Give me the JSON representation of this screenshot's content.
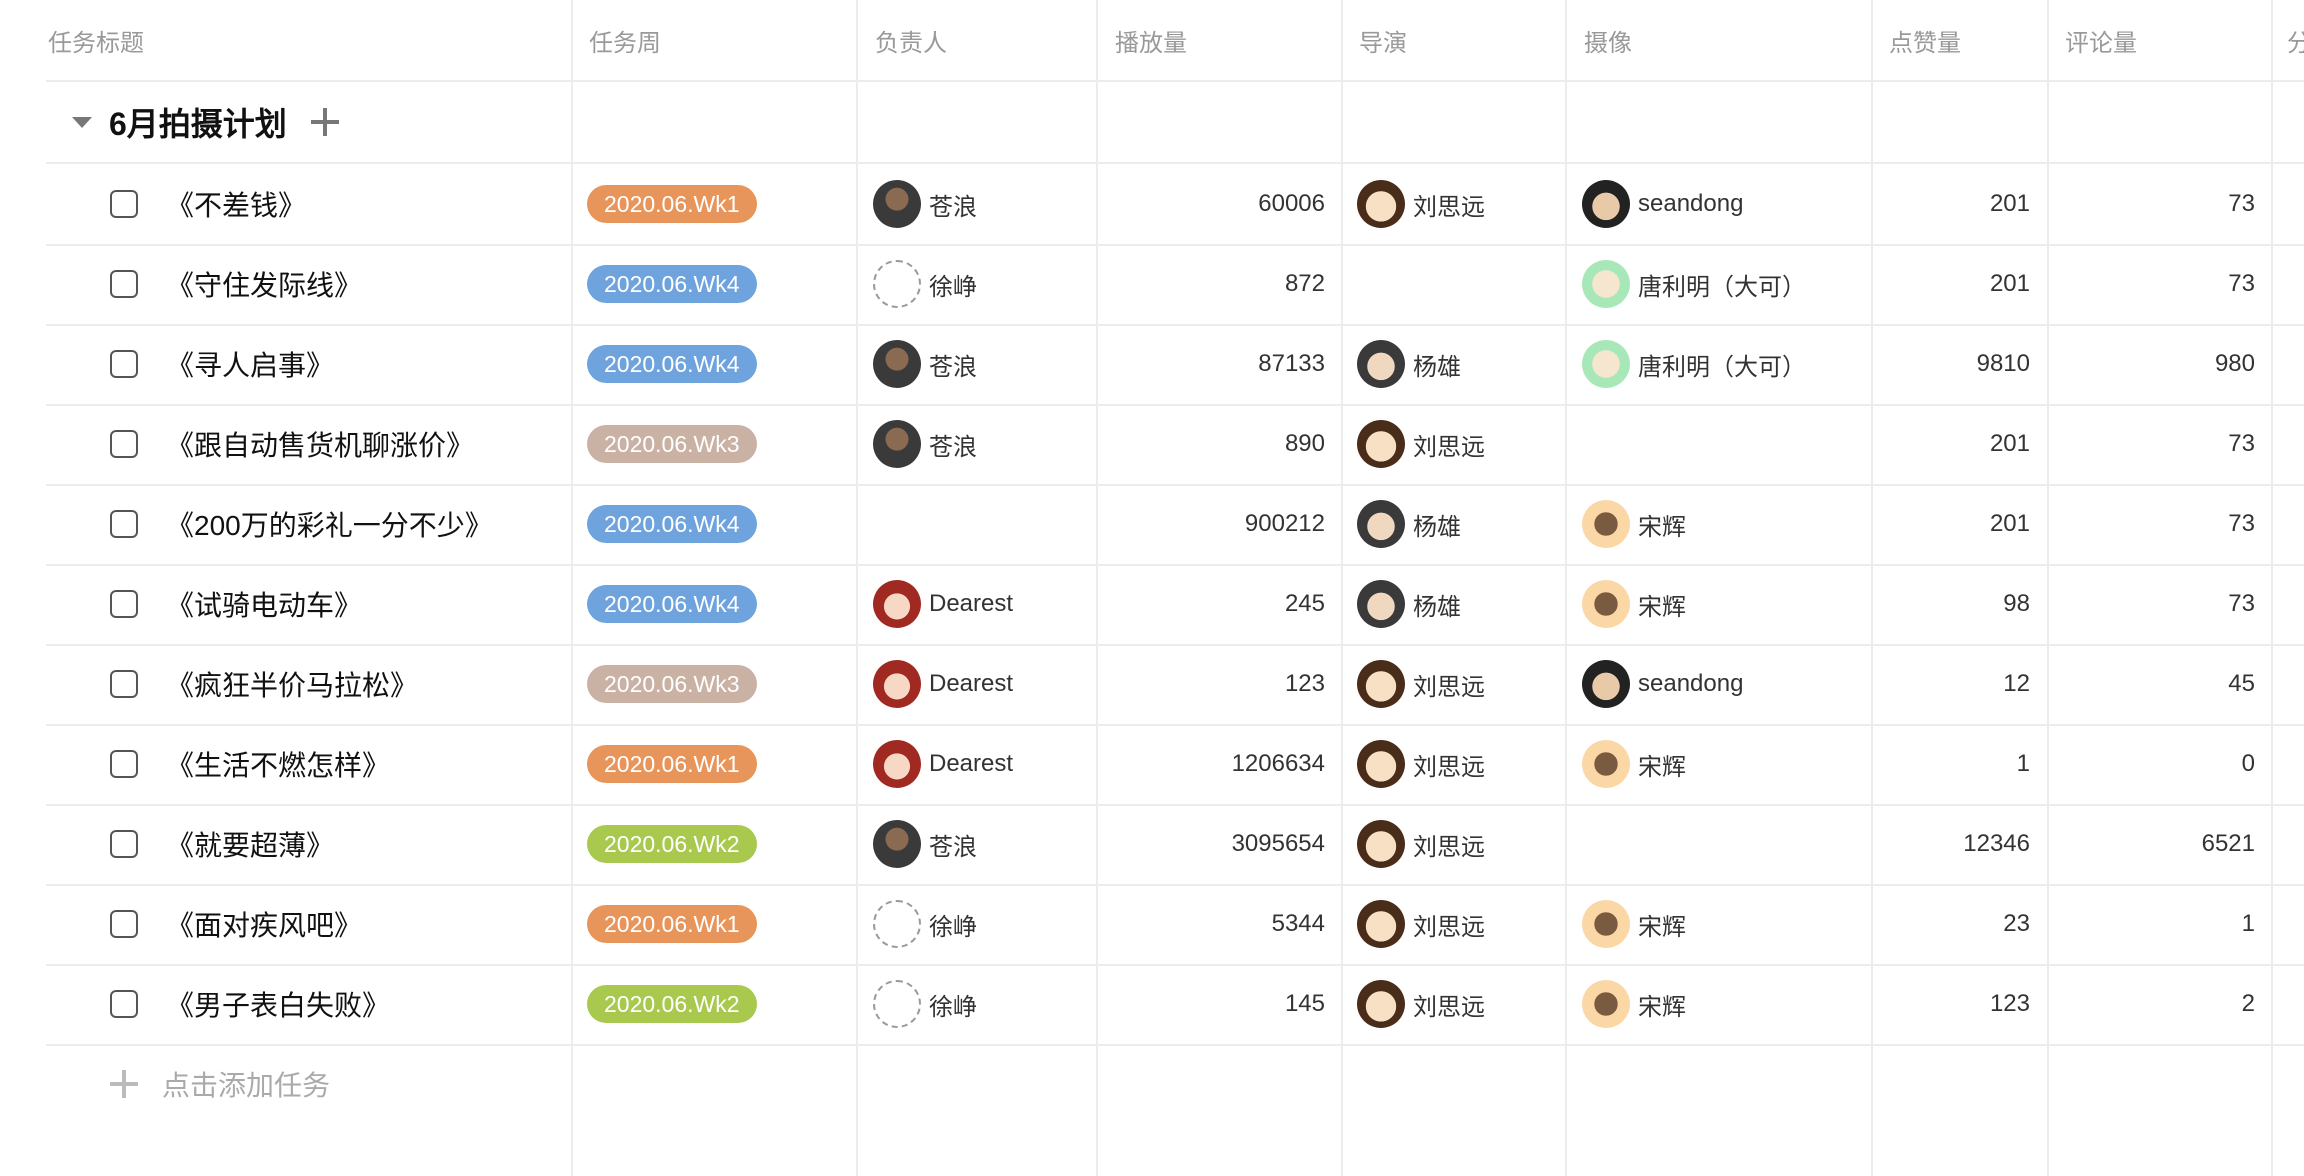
{
  "columns": {
    "title": "任务标题",
    "week": "任务周",
    "owner": "负责人",
    "plays": "播放量",
    "director": "导演",
    "camera": "摄像",
    "likes": "点赞量",
    "comments": "评论量",
    "next": "分"
  },
  "group": {
    "title": "6月拍摄计划",
    "caret_icon": "caret-down-icon",
    "add_icon": "plus-icon"
  },
  "tag_colors": {
    "wk1": "#E8955B",
    "wk2": "#A8C94E",
    "wk3": "#C9B1A4",
    "wk4": "#6FA3DD"
  },
  "rows": [
    {
      "title": "《不差钱》",
      "week": "2020.06.Wk1",
      "week_color": "#E8955B",
      "owner": {
        "name": "苍浪",
        "avatar": "cang"
      },
      "plays": "60006",
      "director": {
        "name": "刘思远",
        "avatar": "liu"
      },
      "camera": {
        "name": "seandong",
        "avatar": "sean"
      },
      "likes": "201",
      "comments": "73"
    },
    {
      "title": "《守住发际线》",
      "week": "2020.06.Wk4",
      "week_color": "#6FA3DD",
      "owner": {
        "name": "徐峥",
        "avatar": "xu"
      },
      "plays": "872",
      "director": null,
      "camera": {
        "name": "唐利明（大可）",
        "avatar": "tang"
      },
      "likes": "201",
      "comments": "73"
    },
    {
      "title": "《寻人启事》",
      "week": "2020.06.Wk4",
      "week_color": "#6FA3DD",
      "owner": {
        "name": "苍浪",
        "avatar": "cang"
      },
      "plays": "87133",
      "director": {
        "name": "杨雄",
        "avatar": "yang"
      },
      "camera": {
        "name": "唐利明（大可）",
        "avatar": "tang"
      },
      "likes": "9810",
      "comments": "980"
    },
    {
      "title": "《跟自动售货机聊涨价》",
      "week": "2020.06.Wk3",
      "week_color": "#C9B1A4",
      "owner": {
        "name": "苍浪",
        "avatar": "cang"
      },
      "plays": "890",
      "director": {
        "name": "刘思远",
        "avatar": "liu"
      },
      "camera": null,
      "likes": "201",
      "comments": "73"
    },
    {
      "title": "《200万的彩礼一分不少》",
      "week": "2020.06.Wk4",
      "week_color": "#6FA3DD",
      "owner": null,
      "plays": "900212",
      "director": {
        "name": "杨雄",
        "avatar": "yang"
      },
      "camera": {
        "name": "宋辉",
        "avatar": "song"
      },
      "likes": "201",
      "comments": "73"
    },
    {
      "title": "《试骑电动车》",
      "week": "2020.06.Wk4",
      "week_color": "#6FA3DD",
      "owner": {
        "name": "Dearest",
        "avatar": "dearest"
      },
      "plays": "245",
      "director": {
        "name": "杨雄",
        "avatar": "yang"
      },
      "camera": {
        "name": "宋辉",
        "avatar": "song"
      },
      "likes": "98",
      "comments": "73"
    },
    {
      "title": "《疯狂半价马拉松》",
      "week": "2020.06.Wk3",
      "week_color": "#C9B1A4",
      "owner": {
        "name": "Dearest",
        "avatar": "dearest"
      },
      "plays": "123",
      "director": {
        "name": "刘思远",
        "avatar": "liu"
      },
      "camera": {
        "name": "seandong",
        "avatar": "sean"
      },
      "likes": "12",
      "comments": "45"
    },
    {
      "title": "《生活不燃怎样》",
      "week": "2020.06.Wk1",
      "week_color": "#E8955B",
      "owner": {
        "name": "Dearest",
        "avatar": "dearest"
      },
      "plays": "1206634",
      "director": {
        "name": "刘思远",
        "avatar": "liu"
      },
      "camera": {
        "name": "宋辉",
        "avatar": "song"
      },
      "likes": "1",
      "comments": "0"
    },
    {
      "title": "《就要超薄》",
      "week": "2020.06.Wk2",
      "week_color": "#A8C94E",
      "owner": {
        "name": "苍浪",
        "avatar": "cang"
      },
      "plays": "3095654",
      "director": {
        "name": "刘思远",
        "avatar": "liu"
      },
      "camera": null,
      "likes": "12346",
      "comments": "6521"
    },
    {
      "title": "《面对疾风吧》",
      "week": "2020.06.Wk1",
      "week_color": "#E8955B",
      "owner": {
        "name": "徐峥",
        "avatar": "xu"
      },
      "plays": "5344",
      "director": {
        "name": "刘思远",
        "avatar": "liu"
      },
      "camera": {
        "name": "宋辉",
        "avatar": "song"
      },
      "likes": "23",
      "comments": "1"
    },
    {
      "title": "《男子表白失败》",
      "week": "2020.06.Wk2",
      "week_color": "#A8C94E",
      "owner": {
        "name": "徐峥",
        "avatar": "xu"
      },
      "plays": "145",
      "director": {
        "name": "刘思远",
        "avatar": "liu"
      },
      "camera": {
        "name": "宋辉",
        "avatar": "song"
      },
      "likes": "123",
      "comments": "2"
    }
  ],
  "add_task": {
    "label": "点击添加任务",
    "icon": "plus-icon"
  }
}
